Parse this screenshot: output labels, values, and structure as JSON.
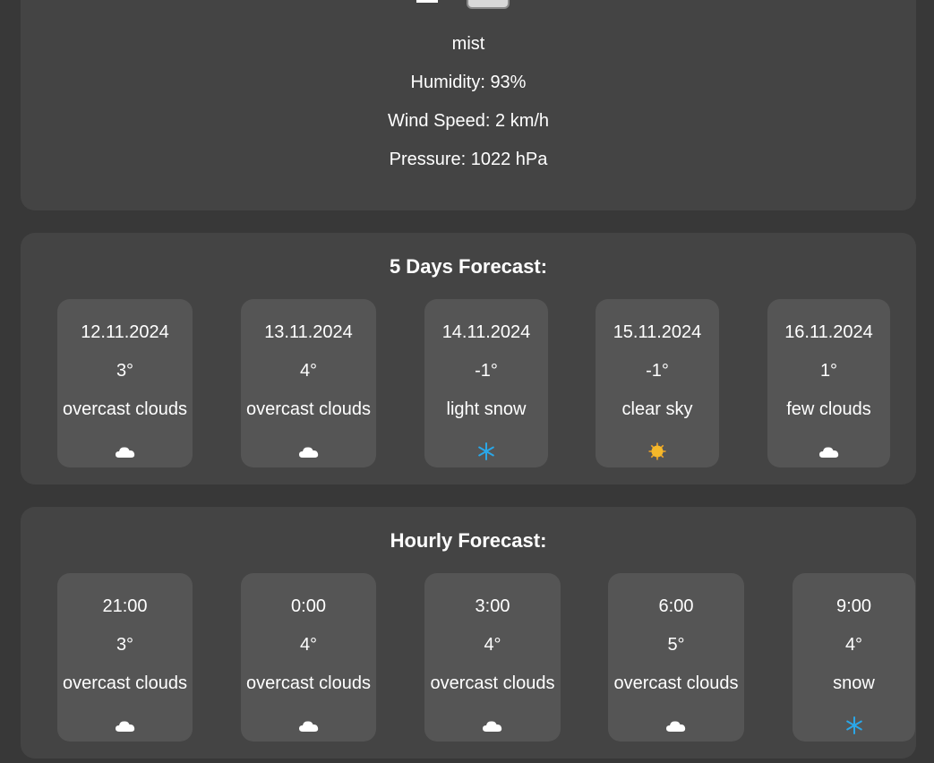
{
  "current": {
    "description": "mist",
    "humidity": "Humidity: 93%",
    "wind": "Wind Speed: 2 km/h",
    "pressure": "Pressure: 1022 hPa"
  },
  "daily": {
    "title": "5 Days Forecast:",
    "items": [
      {
        "date": "12.11.2024",
        "temp": "3°",
        "desc": "overcast clouds",
        "icon": "cloud-icon"
      },
      {
        "date": "13.11.2024",
        "temp": "4°",
        "desc": "overcast clouds",
        "icon": "cloud-icon"
      },
      {
        "date": "14.11.2024",
        "temp": "-1°",
        "desc": "light snow",
        "icon": "snowflake-icon"
      },
      {
        "date": "15.11.2024",
        "temp": "-1°",
        "desc": "clear sky",
        "icon": "sun-icon"
      },
      {
        "date": "16.11.2024",
        "temp": "1°",
        "desc": "few clouds",
        "icon": "cloud-icon"
      }
    ]
  },
  "hourly": {
    "title": "Hourly Forecast:",
    "items": [
      {
        "time": "21:00",
        "temp": "3°",
        "desc": "overcast clouds",
        "icon": "cloud-icon"
      },
      {
        "time": "0:00",
        "temp": "4°",
        "desc": "overcast clouds",
        "icon": "cloud-icon"
      },
      {
        "time": "3:00",
        "temp": "4°",
        "desc": "overcast clouds",
        "icon": "cloud-icon"
      },
      {
        "time": "6:00",
        "temp": "5°",
        "desc": "overcast clouds",
        "icon": "cloud-icon"
      },
      {
        "time": "9:00",
        "temp": "4°",
        "desc": "snow",
        "icon": "snowflake-icon"
      }
    ]
  },
  "colors": {
    "background": "#383838",
    "panel": "#444444",
    "card": "#555555",
    "snow": "#2aa7e8",
    "sun": "#f5a623"
  }
}
